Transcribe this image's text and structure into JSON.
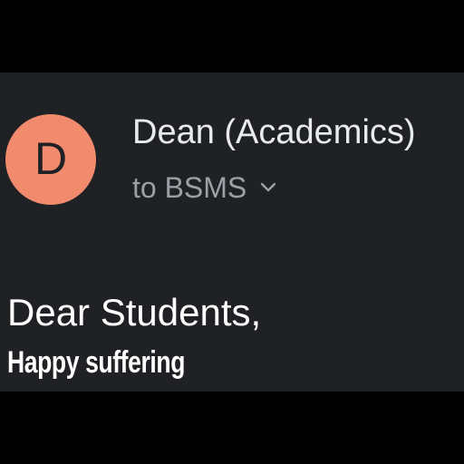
{
  "email": {
    "avatar": {
      "letter": "D",
      "color": "#F28B6D"
    },
    "sender_name": "Dean (Academics)",
    "recipient_label": "to BSMS",
    "expand_icon": "chevron-down-icon"
  },
  "body": {
    "greeting": "Dear Students,"
  },
  "overlay_caption": "Happy suffering",
  "colors": {
    "background": "#202124",
    "primary_text": "#E8EAED",
    "secondary_text": "#9AA0A6",
    "letterbox": "#000000"
  }
}
